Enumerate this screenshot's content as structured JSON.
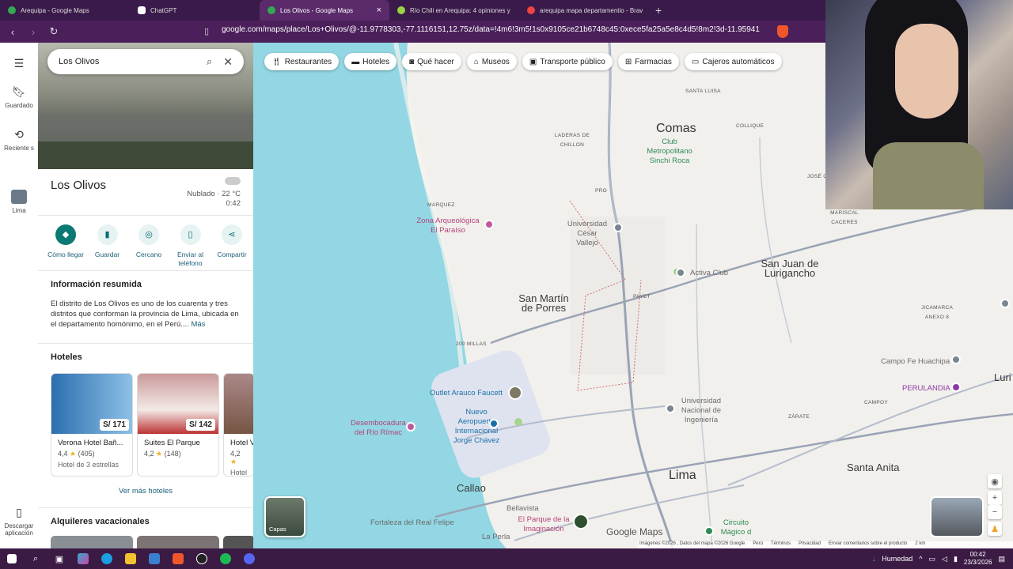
{
  "browser": {
    "tabs": [
      {
        "title": "Arequipa - Google Maps",
        "active": false
      },
      {
        "title": "ChatGPT",
        "active": false
      },
      {
        "title": "Los Olivos - Google Maps",
        "active": true
      },
      {
        "title": "Río Chili en Arequipa: 4 opiniones y",
        "active": false
      },
      {
        "title": "arequipa mapa departamentio - Brav",
        "active": false
      }
    ],
    "url": "google.com/maps/place/Los+Olivos/@-11.9778303,-77.1116151,12.75z/data=!4m6!3m5!1s0x9105ce21b6748c45:0xece5fa25a5e8c4d5!8m2!3d-11.9594191!4d..."
  },
  "rail": {
    "guardado": "Guardado",
    "recientes": "Reciente s",
    "lima": "Lima",
    "descargar": "Descargar aplicación"
  },
  "search": {
    "value": "Los Olivos"
  },
  "place": {
    "title": "Los Olivos",
    "weather": "Nublado · 22 °C",
    "time": "0:42"
  },
  "actions": [
    {
      "label": "Cómo llegar"
    },
    {
      "label": "Guardar"
    },
    {
      "label": "Cercano"
    },
    {
      "label": "Enviar al teléfono"
    },
    {
      "label": "Compartir"
    }
  ],
  "summary": {
    "heading": "Información resumida",
    "text": "El distrito de Los Olivos es uno de los cuarenta y tres distritos que conforman la provincia de Lima, ubicada en el departamento homónimo, en el Perú....",
    "more": "Más"
  },
  "hotels": {
    "heading": "Hoteles",
    "items": [
      {
        "price": "S/ 171",
        "name": "Verona Hotel Bañ...",
        "rating": "4,4",
        "reviews": "(405)",
        "class": "Hotel de 3 estrellas"
      },
      {
        "price": "S/ 142",
        "name": "Suites El Parque",
        "rating": "4,2",
        "reviews": "(148)",
        "class": ""
      },
      {
        "price": "",
        "name": "Hotel V",
        "rating": "4,2",
        "reviews": "",
        "class": "Hotel d"
      }
    ],
    "more": "Ver más hoteles"
  },
  "rentals": {
    "heading": "Alquileres vacacionales"
  },
  "chips": [
    "Restaurantes",
    "Hoteles",
    "Qué hacer",
    "Museos",
    "Transporte público",
    "Farmacias",
    "Cajeros automáticos"
  ],
  "map": {
    "places": {
      "comas": "Comas",
      "santa_luisa": "SANTA LUISA",
      "collique": "COLLIQUE",
      "laderas": "LADERAS DE CHILLON",
      "club": "Club Metropolitano Sinchi Roca",
      "jose": "JOSÉ C",
      "marquez": "MARQUEZ",
      "zona": "Zona Arqueológica El Paraíso",
      "ucv": "Universidad César Vallejo",
      "pro": "PRO",
      "sjl": "San Juan de Lurigancho",
      "activa": "Activa Club",
      "smp": "San Martín de Porres",
      "payet": "PAYET",
      "jicamarca": "JICAMARCA ANEXO 8",
      "millas": "200 MILLAS",
      "campo": "Campo Fe Huachipa",
      "perulandia": "PERULANDIA",
      "outlet": "Outlet Arauco Faucett",
      "aeropuerto": "Nuevo Aeropuerto Internacional Jorge Chávez",
      "uni": "Universidad Nacional de Ingeniería",
      "campoy": "CAMPOY",
      "desembocadura": "Desembocadura del Río Rímac",
      "zarate": "ZÁRATE",
      "callao": "Callao",
      "lima": "Lima",
      "santa_anita": "Santa Anita",
      "bellavista": "Bellavista",
      "parque": "El Parque de la Imaginación",
      "fortaleza": "Fortaleza del Real Felipe",
      "perla": "La Perla",
      "circuito": "Circuito Mágico d",
      "mariscal": "MARISCAL CACERES",
      "luri": "Luri"
    },
    "road_labels": [
      "1N",
      "1N",
      "20",
      "20",
      "20",
      "20",
      "100",
      "205",
      "208",
      "1N",
      "119",
      "20"
    ],
    "layers_label": "Capas",
    "logo": "Google Maps",
    "attribution": [
      "Imágenes ©2026 , Datos del mapa ©2026 Google",
      "Perú",
      "Términos",
      "Privacidad",
      "Enviar comentarios sobre el producto",
      "2 km"
    ]
  },
  "taskbar": {
    "weather": "Humedad",
    "time": "00:42",
    "date": "23/3/2026"
  }
}
